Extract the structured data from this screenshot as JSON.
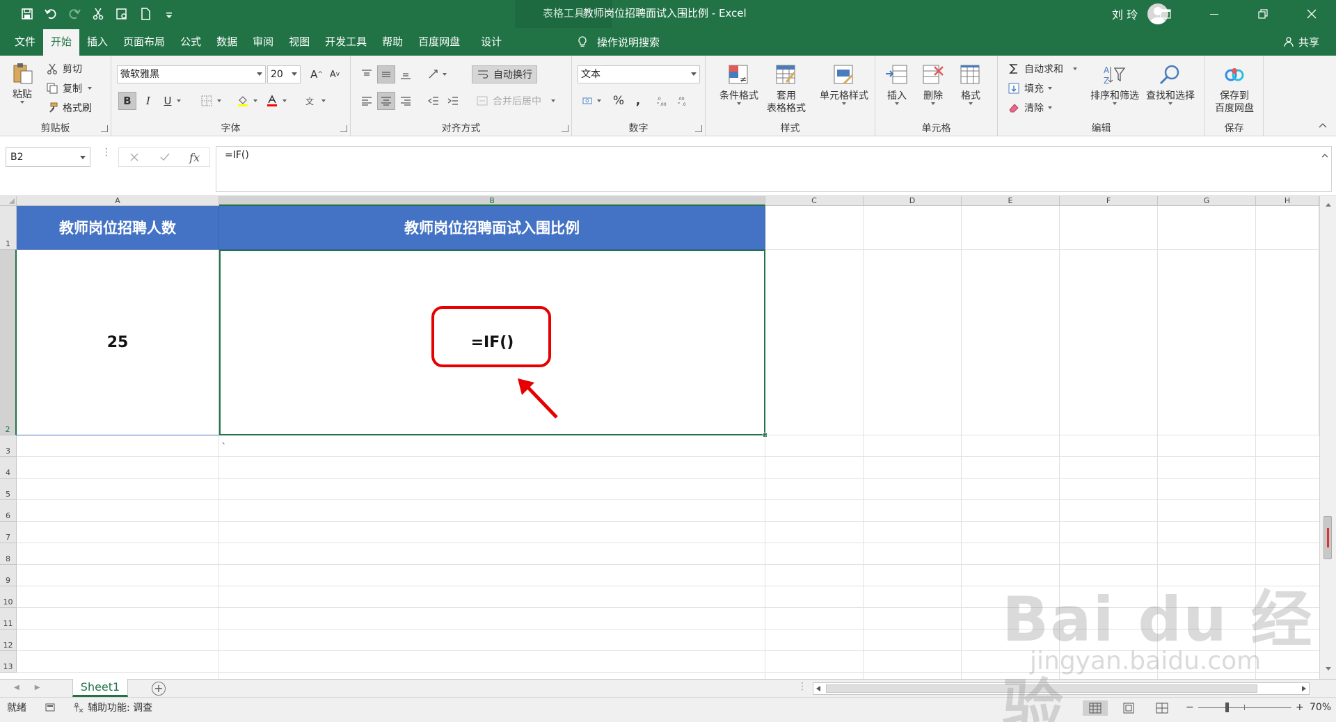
{
  "title_bar": {
    "context_tab": "表格工具",
    "window_title": "教师岗位招聘面试入围比例 - Excel",
    "user_name": "刘 玲"
  },
  "menu_tabs": [
    "文件",
    "开始",
    "插入",
    "页面布局",
    "公式",
    "数据",
    "审阅",
    "视图",
    "开发工具",
    "帮助",
    "百度网盘",
    "设计"
  ],
  "active_tab": "开始",
  "tell_me": "操作说明搜索",
  "share_label": "共享",
  "ribbon": {
    "clipboard": {
      "label": "剪贴板",
      "paste": "粘贴",
      "cut": "剪切",
      "copy": "复制",
      "format_painter": "格式刷"
    },
    "font": {
      "label": "字体",
      "font_name": "微软雅黑",
      "font_size": "20",
      "bold": "B",
      "italic": "I",
      "underline": "U",
      "phonetic": "文"
    },
    "alignment": {
      "label": "对齐方式",
      "wrap_text": "自动换行",
      "merge_center": "合并后居中"
    },
    "number": {
      "label": "数字",
      "format": "文本",
      "percent": "%",
      "comma": ","
    },
    "styles": {
      "label": "样式",
      "conditional": "条件格式",
      "table_format_1": "套用",
      "table_format_2": "表格格式",
      "cell_styles": "单元格样式"
    },
    "cells": {
      "label": "单元格",
      "insert": "插入",
      "delete": "删除",
      "format": "格式"
    },
    "editing": {
      "label": "编辑",
      "autosum": "自动求和",
      "fill": "填充",
      "clear": "清除",
      "sort_filter": "排序和筛选",
      "find_select": "查找和选择"
    },
    "save": {
      "label": "保存",
      "save_to_1": "保存到",
      "save_to_2": "百度网盘"
    }
  },
  "formula_bar": {
    "name_box": "B2",
    "formula": "=IF()",
    "fx": "fx"
  },
  "columns": [
    "A",
    "B",
    "C",
    "D",
    "E",
    "F",
    "G",
    "H"
  ],
  "rows": [
    "1",
    "2",
    "3",
    "4",
    "5",
    "6",
    "7",
    "8",
    "9",
    "10",
    "11",
    "12",
    "13"
  ],
  "cells": {
    "A1": "教师岗位招聘人数",
    "B1": "教师岗位招聘面试入围比例",
    "A2": "25",
    "B2": "=IF()",
    "B3": "、"
  },
  "sheet_tab": "Sheet1",
  "add_sheet": "+",
  "status_bar": {
    "ready": "就绪",
    "accessibility": "辅助功能: 调查",
    "zoom": "70%",
    "zoom_minus": "−",
    "zoom_plus": "+"
  },
  "watermark": {
    "logo": "Bai du 经验",
    "url": "jingyan.baidu.com"
  },
  "colors": {
    "excel_green": "#217346",
    "header_fill": "#4472c4",
    "highlight": "#e60000"
  }
}
